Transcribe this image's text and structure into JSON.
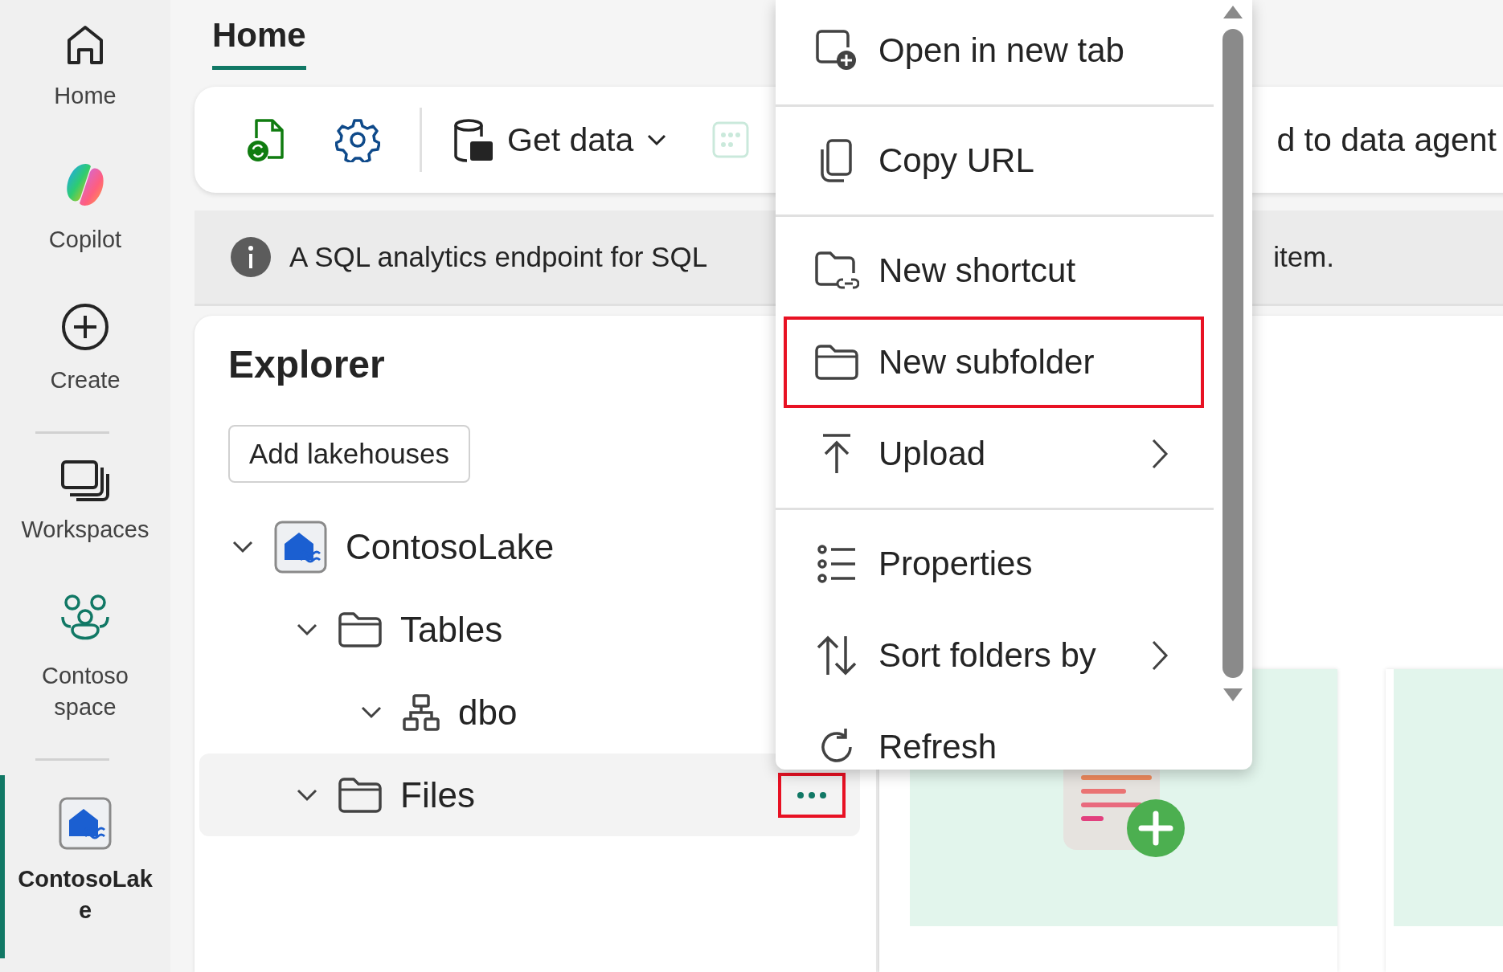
{
  "sidebar": {
    "groups": [
      [
        {
          "label": "Home",
          "selected": false
        },
        {
          "label": "Copilot",
          "selected": false
        },
        {
          "label": "Create",
          "selected": false
        }
      ],
      [
        {
          "label": "Workspaces",
          "selected": false
        },
        {
          "label": "Contoso space",
          "selected": false
        }
      ],
      [
        {
          "label": "ContosoLake",
          "selected": true
        }
      ]
    ]
  },
  "tabs": [
    {
      "label": "Home",
      "selected": true
    }
  ],
  "toolbar": {
    "items": [
      {
        "kind": "sync"
      },
      {
        "kind": "settings"
      },
      {
        "kind": "separator"
      },
      {
        "kind": "dropdown",
        "label": "Get data"
      },
      {
        "kind": "grid",
        "disabled": true
      },
      {
        "kind": "text",
        "label": "d to data agent"
      }
    ]
  },
  "info_bar": {
    "text": "A SQL analytics endpoint for SQL",
    "text_end": "item."
  },
  "explorer": {
    "title": "Explorer",
    "add_button": "Add lakehouses",
    "more_button": {
      "annotated": true
    },
    "tree": [
      {
        "label": "ContosoLake",
        "kind": "lakehouse",
        "expanded": true,
        "selected": false,
        "children": [
          {
            "label": "Tables",
            "kind": "folder",
            "expanded": true,
            "selected": false,
            "children": [
              {
                "label": "dbo",
                "kind": "schema",
                "expanded": true,
                "selected": false
              }
            ]
          },
          {
            "label": "Files",
            "kind": "folder",
            "expanded": true,
            "selected": true
          }
        ]
      }
    ]
  },
  "context_menu": {
    "items": [
      {
        "kind": "item",
        "label": "Open in new tab",
        "submenu": false,
        "highlighted": false
      },
      {
        "kind": "separator"
      },
      {
        "kind": "item",
        "label": "Copy URL",
        "submenu": false,
        "highlighted": false
      },
      {
        "kind": "separator"
      },
      {
        "kind": "item",
        "label": "New shortcut",
        "submenu": false,
        "highlighted": false
      },
      {
        "kind": "item",
        "label": "New subfolder",
        "submenu": false,
        "highlighted": true
      },
      {
        "kind": "item",
        "label": "Upload",
        "submenu": true,
        "highlighted": false
      },
      {
        "kind": "separator"
      },
      {
        "kind": "item",
        "label": "Properties",
        "submenu": false,
        "highlighted": false
      },
      {
        "kind": "item",
        "label": "Sort folders by",
        "submenu": true,
        "highlighted": false
      },
      {
        "kind": "item",
        "label": "Refresh",
        "submenu": false,
        "highlighted": false
      }
    ]
  }
}
